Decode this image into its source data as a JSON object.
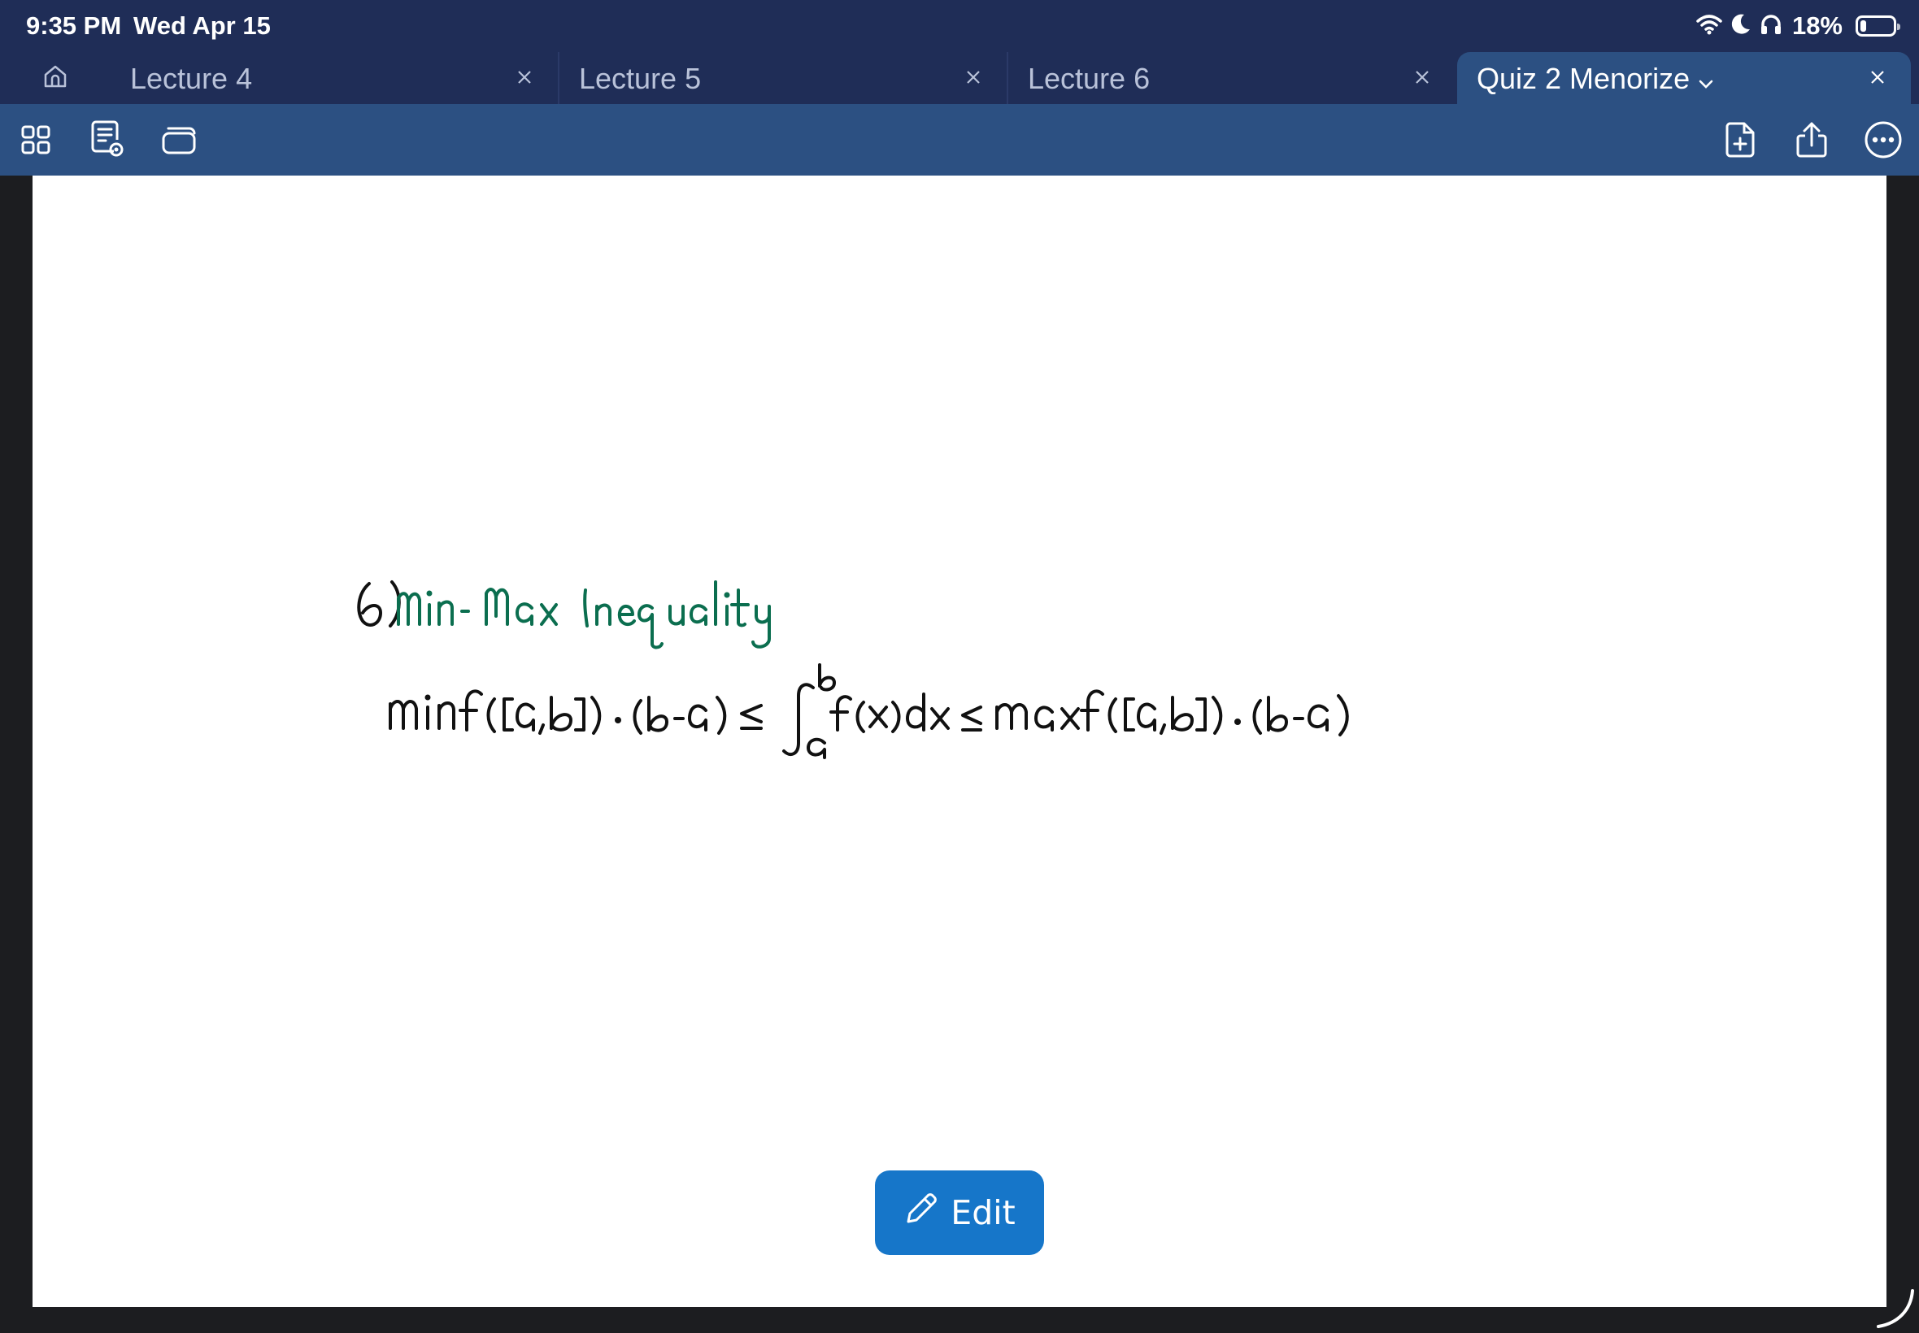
{
  "status_bar": {
    "time": "9:35 PM",
    "date": "Wed Apr 15",
    "battery_percent": "18%",
    "battery_level": 0.18,
    "icons": [
      "wifi-icon",
      "moon-icon",
      "headphones-icon",
      "battery-icon"
    ]
  },
  "tabs": [
    {
      "label": "Lecture 4",
      "active": false
    },
    {
      "label": "Lecture 5",
      "active": false
    },
    {
      "label": "Lecture 6",
      "active": false
    },
    {
      "label": "Quiz 2 Menorize",
      "active": true
    }
  ],
  "toolbar": {
    "left_icons": [
      "grid-view-icon",
      "document-preview-icon",
      "layers-icon"
    ],
    "right_icons": [
      "add-page-icon",
      "share-icon",
      "more-icon"
    ]
  },
  "note": {
    "heading_number": "6)",
    "heading_title": "Min- Max Inequality",
    "equation": "min f([a,b]) · (b-a) ≤ ∫_a^b f(x)dx ≤ max f([a,b]) · (b-a)"
  },
  "edit_button": {
    "label": "Edit",
    "icon": "pencil-icon"
  },
  "colors": {
    "status_bar_bg": "#1f2d57",
    "toolbar_bg": "#2c5082",
    "ink_black": "#111111",
    "ink_green": "#0b6e4f",
    "edit_button_bg": "#1676c9"
  }
}
